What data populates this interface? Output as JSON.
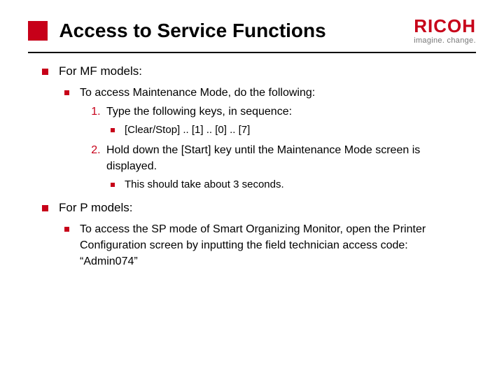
{
  "title": "Access to Service Functions",
  "logo": {
    "word": "RICOH",
    "tagline": "imagine. change."
  },
  "sections": [
    {
      "label": "For MF models:",
      "sub": [
        {
          "label": "To access Maintenance Mode, do the following:",
          "steps": [
            {
              "label": "Type the following keys, in sequence:",
              "notes": [
                "[Clear/Stop] .. [1] .. [0] .. [7]"
              ]
            },
            {
              "label": "Hold down the [Start] key until the Maintenance Mode screen is displayed.",
              "notes": [
                "This should take about 3 seconds."
              ]
            }
          ]
        }
      ]
    },
    {
      "label": "For P models:",
      "sub": [
        {
          "label": "To access the SP mode of Smart Organizing Monitor, open the Printer Configuration screen by inputting the field technician access code: “Admin074”"
        }
      ]
    }
  ]
}
